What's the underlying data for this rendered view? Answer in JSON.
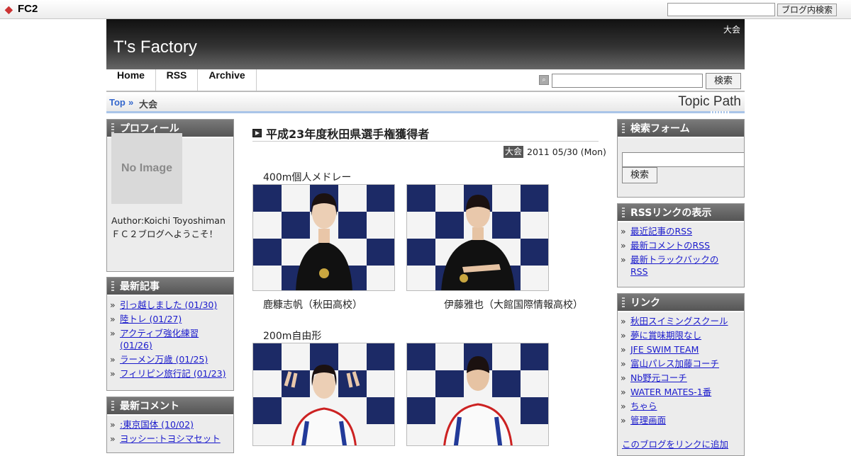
{
  "fc2bar": {
    "logo": "FC2",
    "search_button": "ブログ内検索"
  },
  "header": {
    "title": "T's Factory",
    "tag": "大会"
  },
  "nav": {
    "home": "Home",
    "rss": "RSS",
    "archive": "Archive",
    "search_button": "検索"
  },
  "topic": {
    "top": "Top",
    "sep": "»",
    "current": "大会",
    "title": "Topic Path"
  },
  "profile": {
    "heading": "プロフィール",
    "noimage": "No Image",
    "author": "Author:Koichi Toyoshiman",
    "welcome": "ＦＣ２ブログへようこそ！"
  },
  "recent_articles": {
    "heading": "最新記事",
    "items": [
      "引っ越しました (01/30)",
      "陸トレ (01/27)",
      "アクティブ強化練習 (01/26)",
      "ラーメン万歳 (01/25)",
      "フィリピン旅行記 (01/23)"
    ]
  },
  "recent_comments": {
    "heading": "最新コメント",
    "items": [
      ":東京国体 (10/02)",
      "ヨッシー:トヨシマセット"
    ]
  },
  "article": {
    "title": "平成23年度秋田県選手権獲得者",
    "category": "大会",
    "date": "2011 05/30 (Mon)",
    "section1": "400m個人メドレー",
    "caption1a": "鹿糠志帆（秋田高校）",
    "caption1b": "伊藤雅也（大館国際情報高校）",
    "section2": "200m自由形"
  },
  "search_form": {
    "heading": "検索フォーム",
    "button": "検索"
  },
  "rss_links": {
    "heading": "RSSリンクの表示",
    "items": [
      "最近記事のRSS",
      "最新コメントのRSS",
      "最新トラックバックのRSS"
    ]
  },
  "links": {
    "heading": "リンク",
    "items": [
      "秋田スイミングスクール",
      "夢に賞味期限なし",
      "JFE SWIM TEAM",
      "富山パレス加藤コーチ",
      "Nb野元コーチ",
      "WATER MATES-1番",
      "ちゃら",
      "管理画面"
    ],
    "add_link": "このブログをリンクに追加"
  }
}
